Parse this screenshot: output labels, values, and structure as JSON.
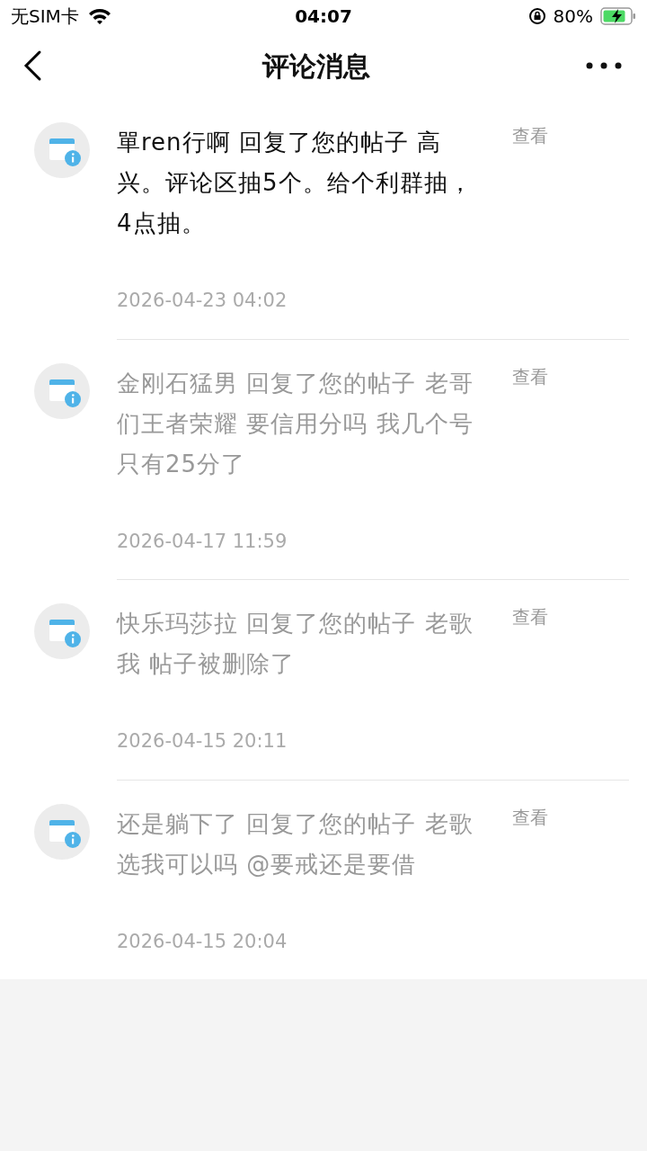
{
  "status_bar": {
    "carrier": "无SIM卡",
    "time": "04:07",
    "battery": "80%"
  },
  "nav": {
    "title": "评论消息"
  },
  "messages": [
    {
      "text": "單ren行啊 回复了您的帖子 高兴。评论区抽5个。给个利群抽，4点抽。",
      "time": "2026-04-23 04:02",
      "action": "查看",
      "read": false
    },
    {
      "text": "金刚石猛男 回复了您的帖子 老哥们王者荣耀 要信用分吗 我几个号只有25分了",
      "time": "2026-04-17 11:59",
      "action": "查看",
      "read": true
    },
    {
      "text": "快乐玛莎拉 回复了您的帖子 老歌我 帖子被删除了",
      "time": "2026-04-15 20:11",
      "action": "查看",
      "read": true
    },
    {
      "text": "还是躺下了 回复了您的帖子 老歌选我可以吗 @要戒还是要借",
      "time": "2026-04-15 20:04",
      "action": "查看",
      "read": true
    }
  ]
}
